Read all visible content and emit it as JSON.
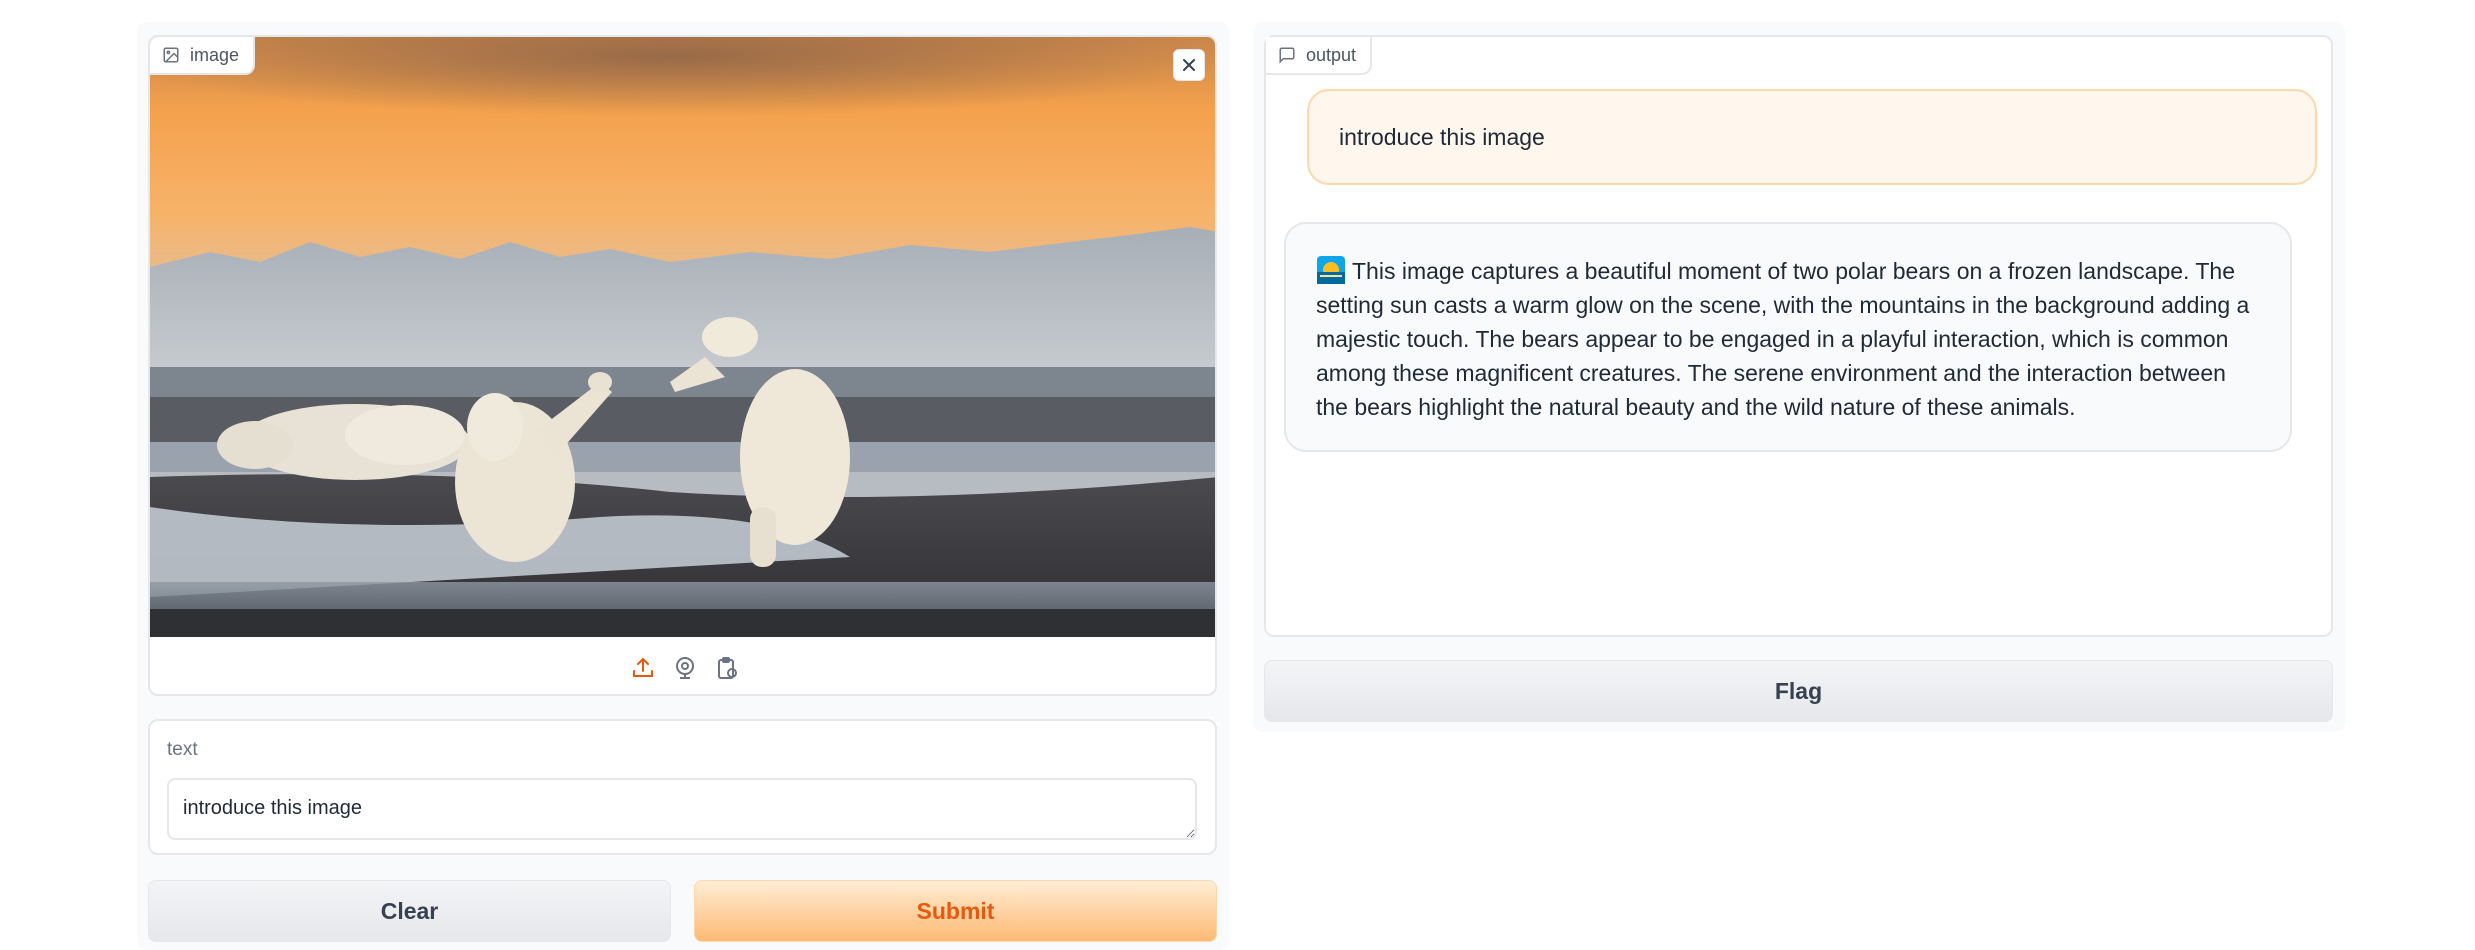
{
  "input_panel": {
    "image_label": "image",
    "image_alt": "Two polar bears playing on a frozen shore at sunset, with a third bear lying down",
    "source_icons": [
      "upload-icon",
      "webcam-icon",
      "clipboard-icon"
    ],
    "text_label": "text",
    "text_value": "introduce this image",
    "clear_label": "Clear",
    "submit_label": "Submit"
  },
  "output_panel": {
    "label": "output",
    "messages": [
      {
        "role": "user",
        "text": "introduce this image"
      },
      {
        "role": "bot",
        "text": "This image captures a beautiful moment of two polar bears on a frozen landscape. The setting sun casts a warm glow on the scene, with the mountains in the background adding a majestic touch. The bears appear to be engaged in a playful interaction, which is common among these magnificent creatures. The serene environment and the interaction between the bears highlight the natural beauty and the wild nature of these animals."
      }
    ],
    "flag_label": "Flag"
  },
  "colors": {
    "accent": "#ea580c",
    "submit_bg": "#fdba74",
    "user_bubble": "#fff7ed",
    "bot_bubble": "#f9fafb"
  }
}
